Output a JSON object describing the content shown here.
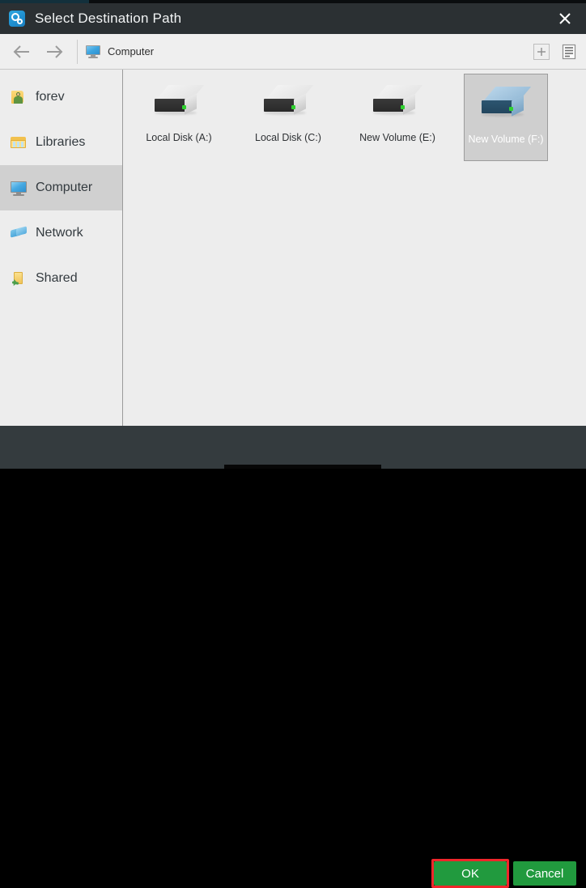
{
  "window": {
    "title": "Select Destination Path",
    "app_icon": "clock-gear-icon",
    "close_icon": "close-icon"
  },
  "toolbar": {
    "back_icon": "arrow-left-icon",
    "forward_icon": "arrow-right-icon",
    "breadcrumb_icon": "computer-icon",
    "breadcrumb_label": "Computer",
    "new_folder_icon": "plus-icon",
    "view_list_icon": "list-view-icon"
  },
  "sidebar": {
    "items": [
      {
        "label": "forev",
        "icon": "user-folder-icon",
        "selected": false
      },
      {
        "label": "Libraries",
        "icon": "libraries-icon",
        "selected": false
      },
      {
        "label": "Computer",
        "icon": "computer-icon",
        "selected": true
      },
      {
        "label": "Network",
        "icon": "network-icon",
        "selected": false
      },
      {
        "label": "Shared",
        "icon": "shared-folder-icon",
        "selected": false
      }
    ]
  },
  "files": {
    "items": [
      {
        "label": "Local Disk (A:)",
        "icon": "hard-drive-icon",
        "selected": false
      },
      {
        "label": "Local Disk (C:)",
        "icon": "hard-drive-icon",
        "selected": false
      },
      {
        "label": "New Volume (E:)",
        "icon": "hard-drive-icon",
        "selected": false
      },
      {
        "label": "New Volume (F:)",
        "icon": "hard-drive-icon",
        "selected": true
      }
    ]
  },
  "footer": {
    "ok_label": "OK",
    "cancel_label": "Cancel"
  },
  "colors": {
    "titlebar_bg": "#2b3033",
    "footer_bg": "#343b3e",
    "pane_bg": "#ededed",
    "accent_green": "#219a3e",
    "highlight_red": "#f0262b",
    "selection_gray": "#cfcfcf",
    "sidebar_selected": "#d0d0d0"
  }
}
